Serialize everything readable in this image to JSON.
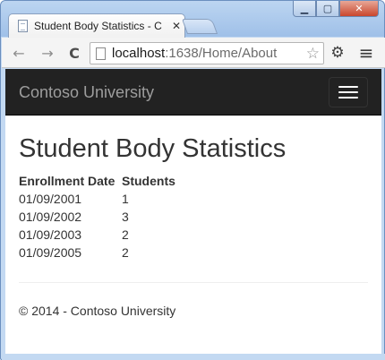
{
  "browser": {
    "tab_title": "Student Body Statistics - C",
    "tab_close": "✕",
    "url_host": "localhost",
    "url_rest": ":1638/Home/About",
    "window_buttons": {
      "minimize": "▁",
      "maximize": "▢",
      "close": "✕"
    },
    "nav": {
      "back": "←",
      "forward": "→",
      "reload": "C"
    },
    "icons": {
      "star": "☆",
      "settings": "⚙",
      "menu": "≡"
    }
  },
  "navbar": {
    "brand": "Contoso University"
  },
  "main": {
    "title": "Student Body Statistics",
    "table": {
      "headers": [
        "Enrollment Date",
        "Students"
      ],
      "rows": [
        [
          "01/09/2001",
          "1"
        ],
        [
          "01/09/2002",
          "3"
        ],
        [
          "01/09/2003",
          "2"
        ],
        [
          "01/09/2005",
          "2"
        ]
      ]
    }
  },
  "footer": {
    "text": "© 2014 - Contoso University"
  }
}
